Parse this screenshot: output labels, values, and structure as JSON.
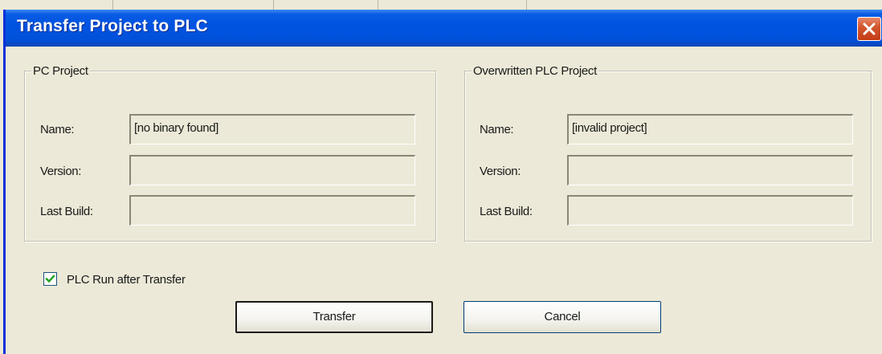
{
  "dialog": {
    "title": "Transfer Project to PLC"
  },
  "pc_project": {
    "legend": "PC Project",
    "name_label": "Name:",
    "name_value": "[no binary found]",
    "version_label": "Version:",
    "version_value": "",
    "last_build_label": "Last Build:",
    "last_build_value": ""
  },
  "plc_project": {
    "legend": "Overwritten PLC Project",
    "name_label": "Name:",
    "name_value": "[invalid project]",
    "version_label": "Version:",
    "version_value": "",
    "last_build_label": "Last Build:",
    "last_build_value": ""
  },
  "options": {
    "plc_run_label": "PLC Run after Transfer",
    "plc_run_checked": true
  },
  "buttons": {
    "transfer": "Transfer",
    "cancel": "Cancel"
  },
  "colors": {
    "titlebar": "#0053e1",
    "dialog_bg": "#ece9d8",
    "close_button": "#c33c17"
  },
  "icons": {
    "close": "close-x-icon",
    "checkmark": "checkmark-icon"
  }
}
